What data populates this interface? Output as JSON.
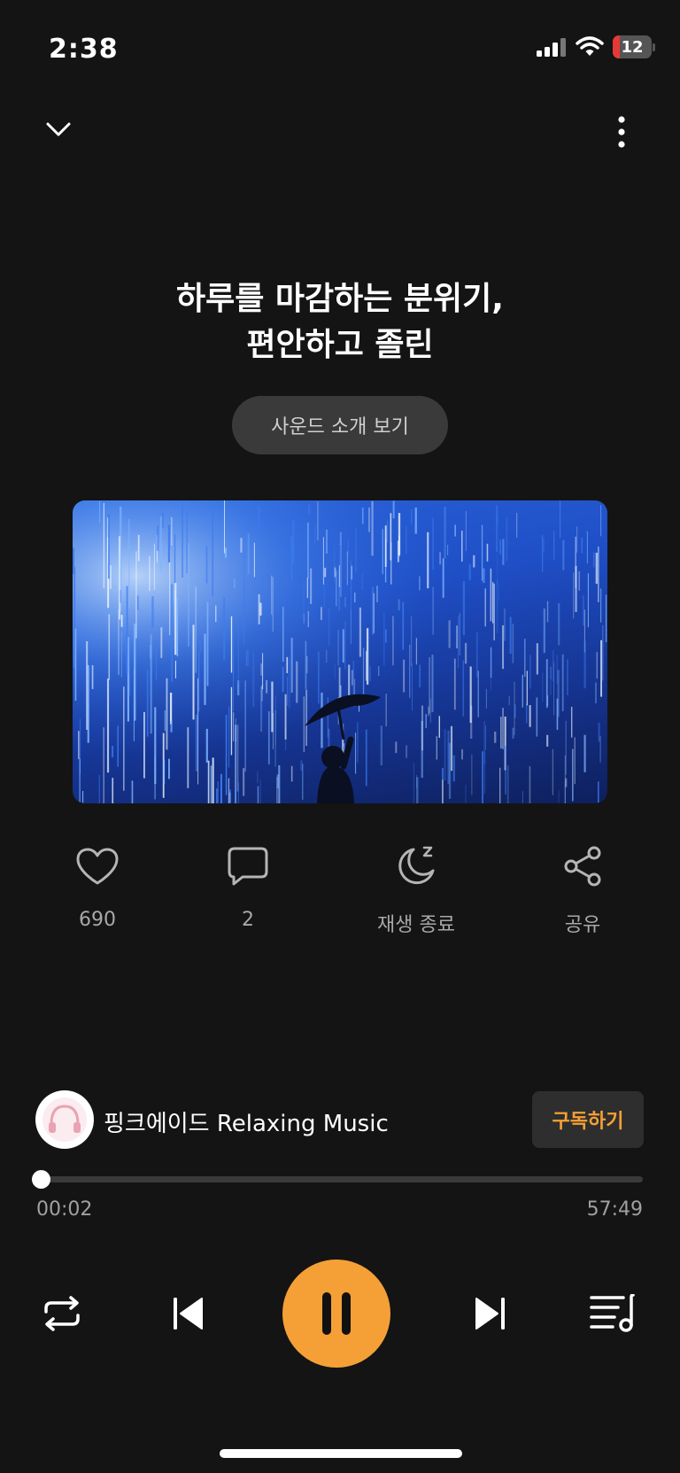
{
  "status_bar": {
    "time": "2:38",
    "battery": "12",
    "icons": [
      "cellular-signal-icon",
      "wifi-icon",
      "battery-icon"
    ]
  },
  "header": {
    "collapse_icon": "chevron-down-icon",
    "more_icon": "more-vertical-icon"
  },
  "title": {
    "line1": "하루를 마감하는 분위기,",
    "line2": "편안하고 졸린"
  },
  "intro_button": {
    "label": "사운드 소개 보기"
  },
  "actions": [
    {
      "icon": "heart-icon",
      "label": "690"
    },
    {
      "icon": "comment-icon",
      "label": "2"
    },
    {
      "icon": "sleep-timer-icon",
      "label": "재생 종료"
    },
    {
      "icon": "share-icon",
      "label": "공유"
    }
  ],
  "channel": {
    "name": "핑크에이드 Relaxing Music",
    "subscribe_label": "구독하기"
  },
  "progress": {
    "current": "00:02",
    "total": "57:49",
    "fraction": 0.0006
  },
  "controls": [
    "repeat-icon",
    "previous-icon",
    "pause-icon",
    "next-icon",
    "playlist-icon"
  ],
  "colors": {
    "background": "#141414",
    "accent": "#f5a036",
    "muted_text": "#a8a8a8"
  }
}
